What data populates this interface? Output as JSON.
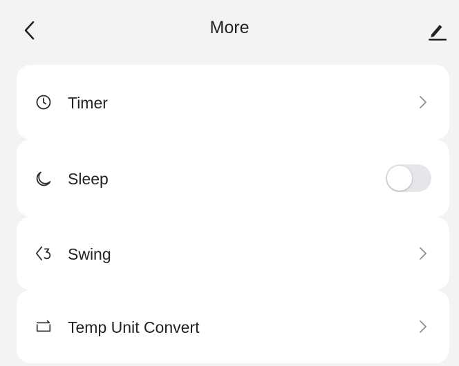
{
  "header": {
    "title": "More",
    "back_icon": "chevron-left-icon",
    "edit_icon": "pencil-icon"
  },
  "items": [
    {
      "label": "Timer",
      "icon": "clock-icon",
      "control": "chevron"
    },
    {
      "label": "Sleep",
      "icon": "moon-icon",
      "control": "toggle",
      "enabled": false
    },
    {
      "label": "Swing",
      "icon": "swing-icon",
      "control": "chevron"
    },
    {
      "label": "Temp Unit Convert",
      "icon": "convert-icon",
      "control": "chevron"
    }
  ],
  "colors": {
    "background": "#f3f3f5",
    "card": "#ffffff",
    "text": "#222222",
    "icon": "#2a2a2a",
    "chevron": "#8e8e93",
    "toggle_off": "#e6e6ea"
  }
}
